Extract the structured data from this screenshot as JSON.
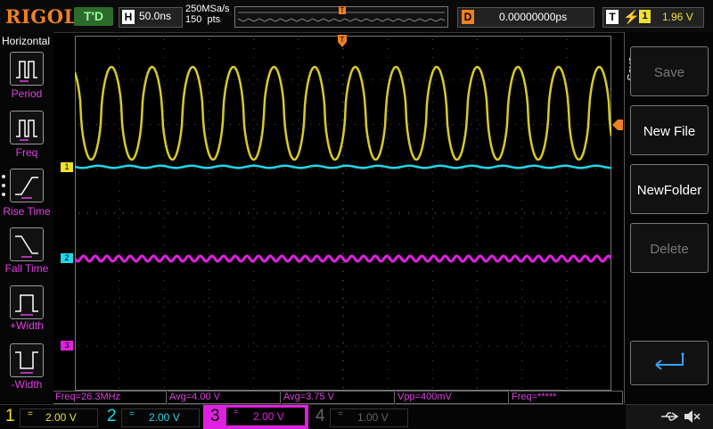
{
  "top": {
    "logo": "RIGOL",
    "trigger_status": "T'D",
    "horizontal_letter": "H",
    "timebase": "50.0ns",
    "sample_rate": "250MSa/s",
    "memory_depth": "150  pts",
    "delay_letter": "D",
    "delay": "0.00000000ps",
    "trigger_letter": "T",
    "trigger_source": "1",
    "trigger_level": "1.96 V"
  },
  "left_menu": {
    "title": "Horizontal",
    "items": [
      {
        "label": "Period",
        "icon": "period-icon"
      },
      {
        "label": "Freq",
        "icon": "freq-icon"
      },
      {
        "label": "Rise Time",
        "icon": "rise-time-icon"
      },
      {
        "label": "Fall Time",
        "icon": "fall-time-icon"
      },
      {
        "label": "+Width",
        "icon": "positive-width-icon"
      },
      {
        "label": "-Width",
        "icon": "negative-width-icon"
      }
    ]
  },
  "channel_markers": [
    "1",
    "2",
    "3"
  ],
  "measurements": [
    {
      "text": "Freq=26.3MHz"
    },
    {
      "text": "Avg=4.00 V"
    },
    {
      "text": "Avg=3.75 V"
    },
    {
      "text": "Vpp=400mV"
    },
    {
      "text": "Freq=*****"
    }
  ],
  "channels": [
    {
      "number": "1",
      "scale": "2.00 V",
      "color": "#f0e030"
    },
    {
      "number": "2",
      "scale": "2.00 V",
      "color": "#20d8e8"
    },
    {
      "number": "3",
      "scale": "2.00 V",
      "color": "#e020e0"
    },
    {
      "number": "4",
      "scale": "1.00 V",
      "color": "#666666"
    }
  ],
  "right_menu": {
    "title": "Save",
    "buttons": [
      {
        "label": "Save",
        "enabled": false
      },
      {
        "label": "New File",
        "enabled": true
      },
      {
        "label": "NewFolder",
        "enabled": true
      },
      {
        "label": "Delete",
        "enabled": false
      }
    ],
    "return_icon": "return-arrow-icon"
  },
  "colors": {
    "ch1": "#f0e030",
    "ch2": "#20d8e8",
    "ch3": "#e020e0",
    "trigger": "#f08020",
    "measure_text": "#e040e0"
  }
}
